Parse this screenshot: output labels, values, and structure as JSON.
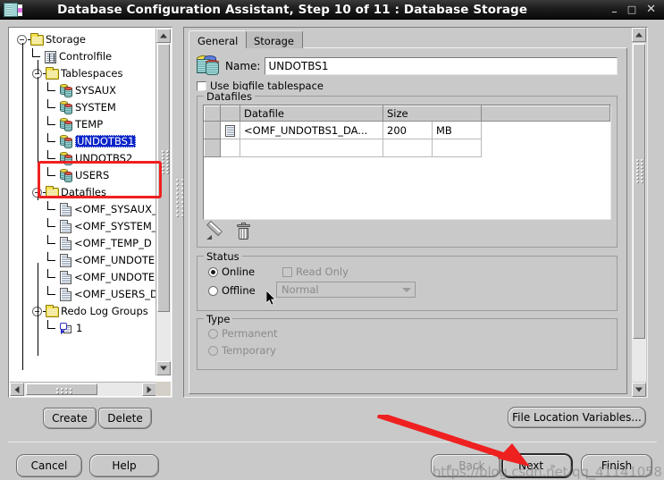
{
  "window": {
    "title": "Database Configuration Assistant, Step 10 of 11 : Database Storage",
    "icon": "database-icon",
    "minimize": "–",
    "maximize": "□",
    "close": "✕"
  },
  "tree": {
    "nodes": [
      {
        "label": "Storage",
        "icon": "folder-icon",
        "depth": 0,
        "toggle": "expanded"
      },
      {
        "label": "Controlfile",
        "icon": "controlfile-icon",
        "depth": 1,
        "toggle": "none"
      },
      {
        "label": "Tablespaces",
        "icon": "folder-icon",
        "depth": 1,
        "toggle": "expanded"
      },
      {
        "label": "SYSAUX",
        "icon": "tablespace-icon",
        "depth": 2,
        "toggle": "none"
      },
      {
        "label": "SYSTEM",
        "icon": "tablespace-icon",
        "depth": 2,
        "toggle": "none"
      },
      {
        "label": "TEMP",
        "icon": "tablespace-icon",
        "depth": 2,
        "toggle": "none"
      },
      {
        "label": "UNDOTBS1",
        "icon": "tablespace-icon",
        "depth": 2,
        "toggle": "none",
        "selected": true
      },
      {
        "label": "UNDOTBS2",
        "icon": "tablespace-icon",
        "depth": 2,
        "toggle": "none"
      },
      {
        "label": "USERS",
        "icon": "tablespace-icon",
        "depth": 2,
        "toggle": "none"
      },
      {
        "label": "Datafiles",
        "icon": "folder-icon",
        "depth": 1,
        "toggle": "expanded"
      },
      {
        "label": "<OMF_SYSAUX_",
        "icon": "datafile-icon",
        "depth": 2,
        "toggle": "none"
      },
      {
        "label": "<OMF_SYSTEM_",
        "icon": "datafile-icon",
        "depth": 2,
        "toggle": "none"
      },
      {
        "label": "<OMF_TEMP_D",
        "icon": "datafile-icon",
        "depth": 2,
        "toggle": "none"
      },
      {
        "label": "<OMF_UNDOTE",
        "icon": "datafile-icon",
        "depth": 2,
        "toggle": "none"
      },
      {
        "label": "<OMF_UNDOTE",
        "icon": "datafile-icon",
        "depth": 2,
        "toggle": "none"
      },
      {
        "label": "<OMF_USERS_D",
        "icon": "datafile-icon",
        "depth": 2,
        "toggle": "none"
      },
      {
        "label": "Redo Log Groups",
        "icon": "folder-icon",
        "depth": 1,
        "toggle": "expanded"
      },
      {
        "label": "1",
        "icon": "redolog-icon",
        "depth": 2,
        "toggle": "none"
      }
    ],
    "highlight_color": "#ef2020",
    "selection_color": "#0a24c8"
  },
  "detail": {
    "tabs": [
      {
        "label": "General",
        "active": true
      },
      {
        "label": "Storage",
        "active": false
      }
    ],
    "name_label": "Name:",
    "name_value": "UNDOTBS1",
    "bigfile_checkbox": "Use bigfile tablespace",
    "datafiles": {
      "group_title": "Datafiles",
      "columns": [
        "",
        "",
        "Datafile",
        "Size",
        ""
      ],
      "rows": [
        {
          "icon": "datafile-icon",
          "datafile": "<OMF_UNDOTBS1_DA...",
          "size": "200",
          "unit": "MB"
        },
        {
          "icon": "",
          "datafile": "",
          "size": "",
          "unit": ""
        }
      ],
      "toolbar": [
        {
          "name": "edit-pencil-icon",
          "label": "Edit"
        },
        {
          "name": "delete-trash-icon",
          "label": "Delete"
        }
      ]
    },
    "status": {
      "group_title": "Status",
      "online_label": "Online",
      "offline_label": "Offline",
      "online_selected": true,
      "read_only_label": "Read Only",
      "read_only_checked": false,
      "offline_mode_value": "Normal"
    },
    "type": {
      "group_title": "Type",
      "permanent_label": "Permanent",
      "temporary_label": "Temporary"
    }
  },
  "buttons": {
    "create": "Create",
    "delete": "Delete",
    "file_location_variables": "File Location Variables...",
    "cancel": "Cancel",
    "help": "Help",
    "back": "Back",
    "back_chevron": "«",
    "next": "Next",
    "next_chevron": "»",
    "finish": "Finish"
  },
  "watermark": "https://blog.csdn.net/qq_41141058"
}
